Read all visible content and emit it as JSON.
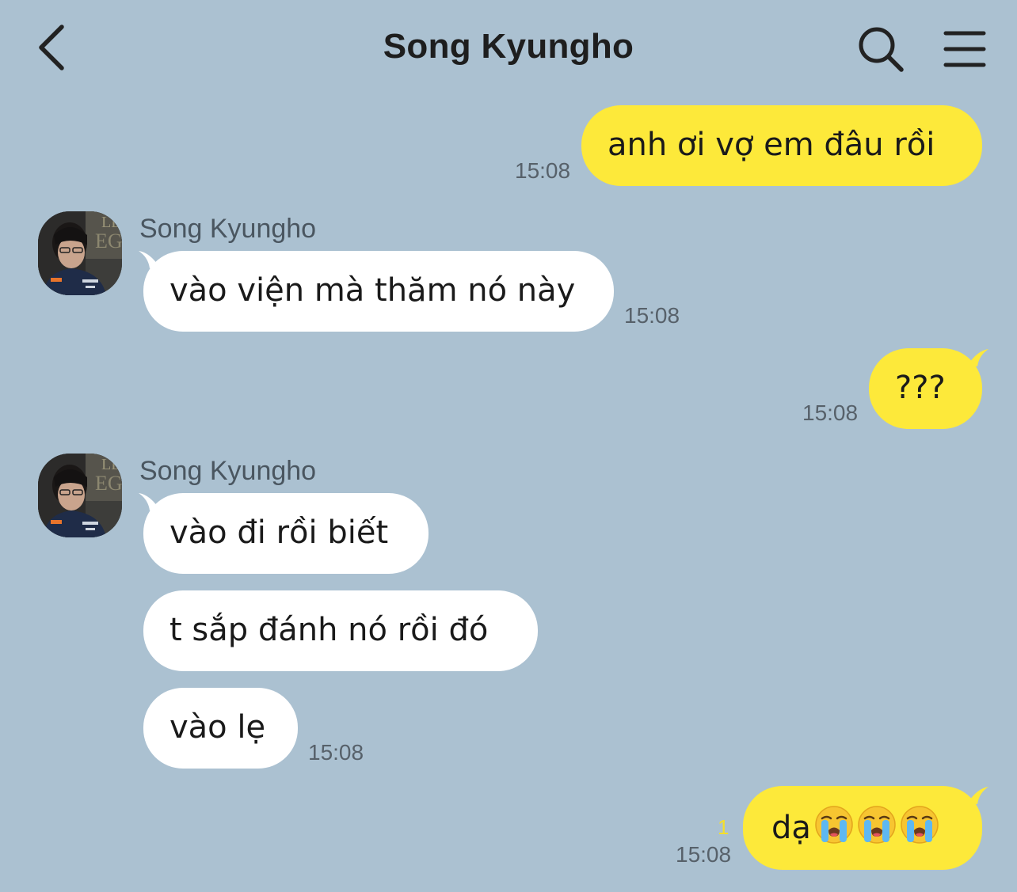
{
  "header": {
    "back_icon": "chevron-left-icon",
    "title": "Song Kyungho",
    "search_icon": "search-icon",
    "menu_icon": "hamburger-menu-icon"
  },
  "messages": [
    {
      "direction": "out",
      "text": "anh ơi vợ em đâu rồi",
      "time": "15:08"
    },
    {
      "direction": "in",
      "sender": "Song Kyungho",
      "text": "vào viện mà thăm nó này",
      "time": "15:08"
    },
    {
      "direction": "out",
      "text": "???",
      "time": "15:08"
    },
    {
      "direction": "in",
      "sender": "Song Kyungho",
      "text": "vào đi rồi biết"
    },
    {
      "direction": "in",
      "text": "t sắp đánh nó rồi đó"
    },
    {
      "direction": "in",
      "text": "vào lẹ",
      "time": "15:08"
    },
    {
      "direction": "out",
      "text": "dạ",
      "emoji": [
        "loudly-crying-face",
        "loudly-crying-face",
        "loudly-crying-face"
      ],
      "time": "15:08",
      "unread": "1"
    }
  ],
  "colors": {
    "background": "#abc1d1",
    "outgoing_bubble": "#fde93a",
    "incoming_bubble": "#ffffff",
    "unread_count": "#f5df2a"
  }
}
